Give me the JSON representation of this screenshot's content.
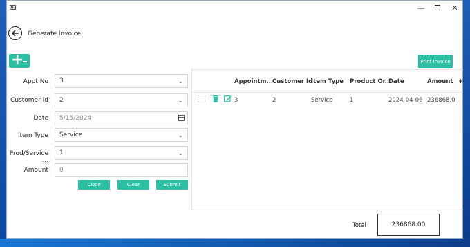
{
  "window": {
    "minimize_glyph": "—",
    "close_glyph": "✕"
  },
  "header": {
    "title": "Generate Invoice"
  },
  "toolbar": {
    "print_label": "Print Invoice"
  },
  "form": {
    "appt_no_label": "Appt No",
    "appt_no_value": "3",
    "customer_id_label": "Customer Id",
    "customer_id_value": "2",
    "date_label": "Date",
    "date_value": "5/15/2024",
    "item_type_label": "Item Type",
    "item_type_value": "Service",
    "prod_service_label": "Prod/Service ...",
    "prod_service_value": "1",
    "amount_label": "Amount",
    "amount_value": "0",
    "close_label": "Close",
    "clear_label": "Clear",
    "submit_label": "Submit"
  },
  "table": {
    "columns": [
      "Appointm...",
      "Customer Id",
      "Item Type",
      "Product Or...",
      "Date",
      "Amount"
    ],
    "add_column_glyph": "+",
    "rows": [
      [
        "3",
        "2",
        "Service",
        "1",
        "2024-04-06",
        "236868.0"
      ]
    ]
  },
  "footer": {
    "total_label": "Total",
    "total_value": "236868.00"
  },
  "colors": {
    "accent": "#2bbfa4",
    "delete_icon": "#2bbfa4",
    "desktop": "#1565c0"
  }
}
